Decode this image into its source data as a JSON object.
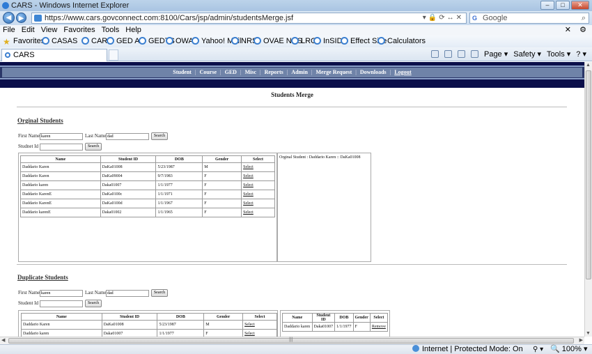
{
  "window": {
    "title": "CARS - Windows Internet Explorer",
    "buttons": [
      "–",
      "□",
      "✕"
    ]
  },
  "addressbar": {
    "url": "https://www.cars.govconnect.com:8100/Cars/jsp/admin/studentsMerge.jsf",
    "search_placeholder": "Google",
    "search_logo": "G",
    "icon_strip": "▾🔒⟳↔✕"
  },
  "menu": [
    "File",
    "Edit",
    "View",
    "Favorites",
    "Tools",
    "Help"
  ],
  "favorites": {
    "label": "Favorites",
    "items": [
      "CASAS",
      "CARS",
      "GED AP",
      "GEDTS",
      "OWA",
      "Yahoo! Mail",
      "NRS",
      "OVAE NRS",
      "LRC",
      "InSIDE",
      "Effect Size",
      "Calculators"
    ]
  },
  "tab": {
    "title": "CARS"
  },
  "commandbar": {
    "page": "Page ▾",
    "safety": "Safety ▾",
    "tools": "Tools ▾",
    "help": "? ▾"
  },
  "nav": {
    "links": [
      "Student",
      "Course",
      "GED",
      "Misc",
      "Reports",
      "Admin",
      "Merge Request",
      "Downloads",
      "Logout"
    ],
    "separator": "|"
  },
  "page": {
    "title": "Students Merge"
  },
  "original": {
    "heading": "Orginal Students",
    "first_name_label": "First Name",
    "first_name_value": "karen",
    "last_name_label": "Last Name",
    "last_name_value": "dad",
    "search_label": "Search",
    "student_id_label": "Studnet Id",
    "student_id_value": "",
    "search2_label": "Search",
    "columns": [
      "Name",
      "Student ID",
      "DOB",
      "Gender",
      "Select"
    ],
    "rows": [
      {
        "name": "Daddario Karen",
        "id": "DaKa01008",
        "dob": "5/23/1987",
        "gender": "M",
        "action": "Select"
      },
      {
        "name": "Daddario Karen",
        "id": "DaKa09004",
        "dob": "9/7/1983",
        "gender": "F",
        "action": "Select"
      },
      {
        "name": "Daddario karen",
        "id": "Daka01007",
        "dob": "1/1/1977",
        "gender": "F",
        "action": "Select"
      },
      {
        "name": "Daddario KarenE",
        "id": "DaKa0100c",
        "dob": "1/1/1971",
        "gender": "F",
        "action": "Select"
      },
      {
        "name": "Daddario KarenE",
        "id": "DaKa0100d",
        "dob": "1/1/1967",
        "gender": "F",
        "action": "Select"
      },
      {
        "name": "Daddario karenE",
        "id": "Daka01002",
        "dob": "1/1/1965",
        "gender": "F",
        "action": "Select"
      }
    ],
    "selected_message": "Orginal Student : Daddario Karen :: DaKa01008"
  },
  "duplicate": {
    "heading": "Duplicate Students",
    "first_name_label": "First Name",
    "first_name_value": "karen",
    "last_name_label": "Last Name",
    "last_name_value": "dad",
    "search_label": "Search",
    "student_id_label": "Student Id",
    "student_id_value": "",
    "search2_label": "Search",
    "columns": [
      "Name",
      "Student ID",
      "DOB",
      "Gender",
      "Select"
    ],
    "rows": [
      {
        "name": "Daddario Karen",
        "id": "DaKa01008",
        "dob": "5/23/1987",
        "gender": "M",
        "action": "Select"
      },
      {
        "name": "Daddario karen",
        "id": "Daka01007",
        "dob": "1/1/1977",
        "gender": "F",
        "action": "Select"
      }
    ],
    "selected_columns": [
      "Name",
      "Student ID",
      "DOB",
      "Gender",
      "Select"
    ],
    "selected_rows": [
      {
        "name": "Daddario karen",
        "id": "Daka01007",
        "dob": "1/1/1977",
        "gender": "F",
        "action": "Remove"
      }
    ]
  },
  "status": {
    "zone": "Internet | Protected Mode: On",
    "zoom": "100%",
    "zoom_arrow": "▾",
    "lock_glyphs": "⚲ ▾"
  }
}
